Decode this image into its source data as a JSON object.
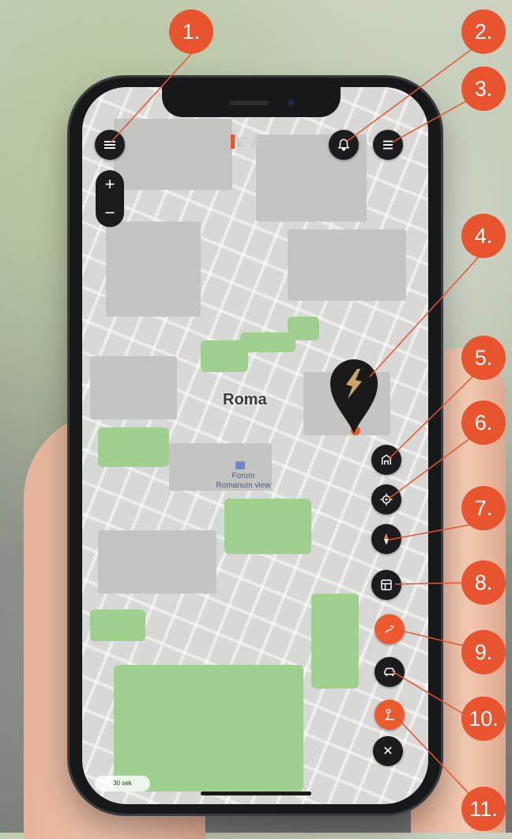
{
  "map": {
    "city_label": "Roma",
    "poi_label": "Forum Romanum view",
    "scale_label": "30 sek"
  },
  "controls": {
    "zoom_in": "+",
    "zoom_out": "−",
    "close_icon": "✕"
  },
  "badges": [
    "1.",
    "2.",
    "3.",
    "4.",
    "5.",
    "6.",
    "7.",
    "8.",
    "9.",
    "10.",
    "11."
  ],
  "colors": {
    "accent": "#e8542e",
    "button_dark": "#1c1c1e",
    "marker_gold": "#c9a36a",
    "park_green": "#9fd08f"
  },
  "icons": {
    "menu": "hamburger-icon",
    "notifications": "bell-icon",
    "list": "list-icon",
    "marker": "brand-marker-icon",
    "3d_view": "building-3d-icon",
    "locate": "crosshair-icon",
    "compass": "compass-icon",
    "map_layers": "map-layer-icon",
    "route_orange": "route-icon",
    "vehicle": "car-icon",
    "gps_orange": "person-location-icon",
    "close": "close-icon"
  }
}
